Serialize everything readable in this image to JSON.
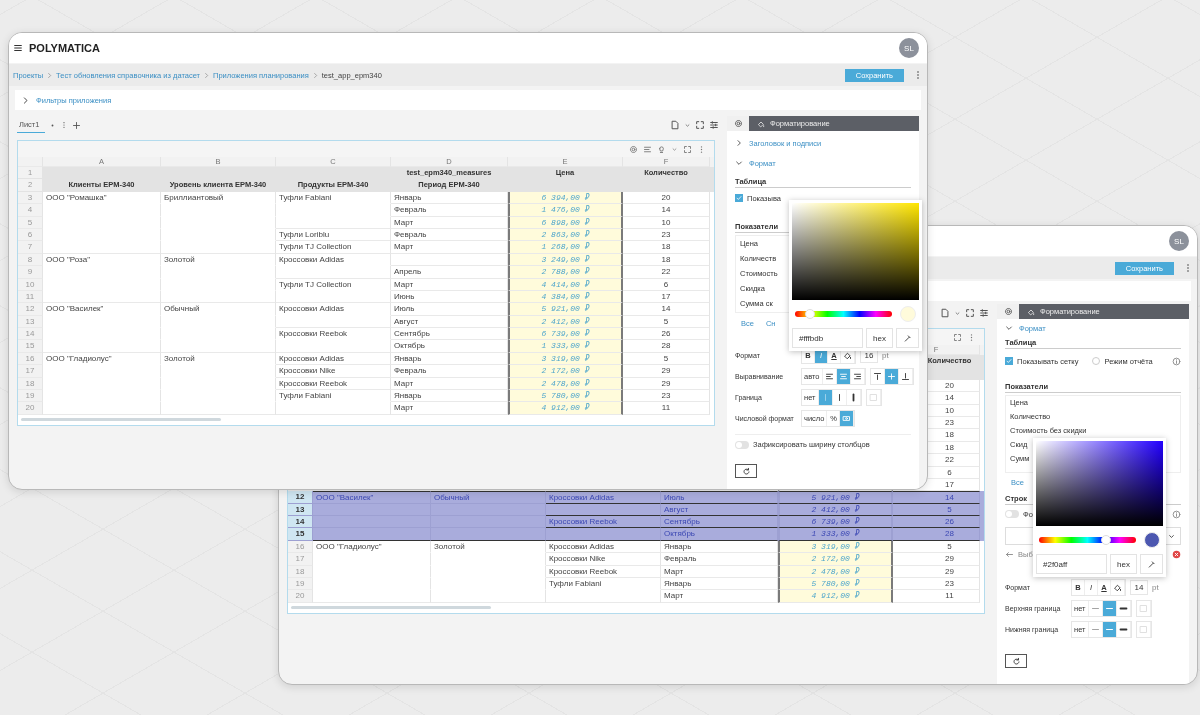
{
  "front_window": {
    "logo": "POLYMATICA",
    "avatar": "SL",
    "breadcrumbs": [
      "Проекты",
      "Тест обновления справочника из датасет",
      "Приложения планирования",
      "test_app_epm340"
    ],
    "save_button": "Сохранить",
    "filters": {
      "label": "Фильтры приложения",
      "expanded": false
    },
    "sheet_tabs": [
      {
        "label": "Лист1",
        "selected": true
      }
    ],
    "table": {
      "header_row_numbers": [
        "1",
        "2"
      ],
      "measures_title": "test_epm340_measures",
      "columns": [
        {
          "letter": "A",
          "title": "Клиенты EPM-340"
        },
        {
          "letter": "B",
          "title": "Уровень клиента EPM-340"
        },
        {
          "letter": "C",
          "title": "Продукты EPM-340"
        },
        {
          "letter": "D",
          "title": "Период EPM-340"
        },
        {
          "letter": "E",
          "title": "Цена"
        },
        {
          "letter": "F",
          "title": "Количество"
        }
      ],
      "rows": [
        {
          "num": "3",
          "client": "ООО \"Ромашка\"",
          "level": "Бриллиантовый",
          "product": "Туфли Fabiani",
          "period": "Январь",
          "price": "6 394,00 ₽",
          "quantity": "20"
        },
        {
          "num": "4",
          "period": "Февраль",
          "price": "1 476,00 ₽",
          "quantity": "14"
        },
        {
          "num": "5",
          "period": "Март",
          "price": "6 898,00 ₽",
          "quantity": "10"
        },
        {
          "num": "6",
          "product": "Туфли Loriblu",
          "period": "Февраль",
          "price": "2 863,00 ₽",
          "quantity": "23"
        },
        {
          "num": "7",
          "product": "Туфли TJ Collection",
          "period": "Март",
          "price": "1 268,00 ₽",
          "quantity": "18"
        },
        {
          "num": "8",
          "client": "ООО \"Роза\"",
          "level": "Золотой",
          "product": "Кроссовки Adidas",
          "price": "3 249,00 ₽",
          "quantity": "18"
        },
        {
          "num": "9",
          "period": "Апрель",
          "price": "2 788,00 ₽",
          "quantity": "22"
        },
        {
          "num": "10",
          "product": "Туфли TJ Collection",
          "period": "Март",
          "price": "4 414,00 ₽",
          "quantity": "6"
        },
        {
          "num": "11",
          "period": "Июнь",
          "price": "4 384,00 ₽",
          "quantity": "17"
        },
        {
          "num": "12",
          "client": "ООО \"Василек\"",
          "level": "Обычный",
          "product": "Кроссовки Adidas",
          "period": "Июль",
          "price": "5 921,00 ₽",
          "quantity": "14"
        },
        {
          "num": "13",
          "period": "Август",
          "price": "2 412,00 ₽",
          "quantity": "5"
        },
        {
          "num": "14",
          "product": "Кроссовки Reebok",
          "period": "Сентябрь",
          "price": "6 739,00 ₽",
          "quantity": "26"
        },
        {
          "num": "15",
          "period": "Октябрь",
          "price": "1 333,00 ₽",
          "quantity": "28"
        },
        {
          "num": "16",
          "client": "ООО \"Гладиолус\"",
          "level": "Золотой",
          "product": "Кроссовки Adidas",
          "period": "Январь",
          "price": "3 319,00 ₽",
          "quantity": "5"
        },
        {
          "num": "17",
          "product": "Кроссовки Nike",
          "period": "Февраль",
          "price": "2 172,00 ₽",
          "quantity": "29"
        },
        {
          "num": "18",
          "product": "Кроссовки Reebok",
          "period": "Март",
          "price": "2 478,00 ₽",
          "quantity": "29"
        },
        {
          "num": "19",
          "product": "Туфли Fabiani",
          "period": "Январь",
          "price": "5 780,00 ₽",
          "quantity": "23"
        },
        {
          "num": "20",
          "period": "Март",
          "price": "4 912,00 ₽",
          "quantity": "11"
        }
      ]
    },
    "panel": {
      "tabs": [
        {
          "kind": "settings",
          "selected": false
        },
        {
          "kind": "formatting",
          "label": "Форматирование",
          "selected": true
        }
      ],
      "sections": [
        {
          "label": "Заголовок и подписи",
          "expanded": false
        },
        {
          "label": "Формат",
          "expanded": true
        }
      ],
      "table_heading": "Таблица",
      "show_grid": {
        "label": "Показыва",
        "checked": true
      },
      "measures_heading": "Показатели",
      "measures": [
        "Цена",
        "Количеств",
        "Стоимость",
        "Скидка",
        "Сумма ск"
      ],
      "links": [
        "Все",
        "Сн"
      ],
      "settings": [
        {
          "label": "Формат",
          "groups": [
            [
              {
                "kind": "bold",
                "label": "B",
                "selected": false
              },
              {
                "kind": "italic",
                "label": "I",
                "selected": true
              },
              {
                "kind": "font-color",
                "label": "A",
                "selected": false
              },
              {
                "kind": "fill",
                "selected": false
              }
            ]
          ],
          "size": "16",
          "unit": "pt"
        },
        {
          "label": "Выравнивание",
          "groups": [
            [
              {
                "kind": "text",
                "label": "авто",
                "selected": false
              },
              {
                "kind": "align-left",
                "selected": false
              },
              {
                "kind": "align-center",
                "selected": true
              },
              {
                "kind": "align-right",
                "selected": false
              }
            ],
            [
              {
                "kind": "valign-top",
                "selected": false
              },
              {
                "kind": "valign-middle",
                "selected": true
              },
              {
                "kind": "valign-bottom",
                "selected": false
              }
            ]
          ]
        },
        {
          "label": "Граница",
          "groups": [
            [
              {
                "kind": "text",
                "label": "нет",
                "selected": false
              },
              {
                "kind": "vline-thin",
                "selected": true
              },
              {
                "kind": "vline-medium",
                "selected": false
              },
              {
                "kind": "vline-thick",
                "selected": false
              }
            ],
            [
              {
                "kind": "swatch",
                "selected": false
              }
            ]
          ]
        },
        {
          "label": "Числовой формат",
          "groups": [
            [
              {
                "kind": "text",
                "label": "число",
                "selected": false
              },
              {
                "kind": "text",
                "label": "%",
                "selected": false
              },
              {
                "kind": "money",
                "selected": true
              }
            ]
          ]
        }
      ],
      "fix_width": {
        "label": "Зафиксировать ширину столбцов",
        "on": false
      },
      "picker": {
        "level": 0.15,
        "color": "#fffbdb",
        "value": "#fffbdb",
        "format": "hex"
      }
    }
  },
  "back_window": {
    "avatar": "SL",
    "save_button": "Сохранить",
    "table": {
      "column_letter": "F",
      "column_title": "Количество",
      "upper_quantities": [
        "20",
        "14",
        "10",
        "23",
        "18",
        "18",
        "22",
        "6",
        "17"
      ],
      "rows": [
        {
          "num": "12",
          "client": "ООО \"Василек\"",
          "level": "Обычный",
          "product": "Кроссовки Adidas",
          "period": "Июль",
          "price": "5 921,00 ₽",
          "quantity": "14",
          "selected": true
        },
        {
          "num": "13",
          "period": "Август",
          "price": "2 412,00 ₽",
          "quantity": "5",
          "selected": true
        },
        {
          "num": "14",
          "product": "Кроссовки Reebok",
          "period": "Сентябрь",
          "price": "6 739,00 ₽",
          "quantity": "26",
          "selected": true
        },
        {
          "num": "15",
          "period": "Октябрь",
          "price": "1 333,00 ₽",
          "quantity": "28",
          "selected": true
        },
        {
          "num": "16",
          "client": "ООО \"Гладиолус\"",
          "level": "Золотой",
          "product": "Кроссовки Adidas",
          "period": "Январь",
          "price": "3 319,00 ₽",
          "quantity": "5",
          "selected": false
        },
        {
          "num": "17",
          "product": "Кроссовки Nike",
          "period": "Февраль",
          "price": "2 172,00 ₽",
          "quantity": "29",
          "selected": false
        },
        {
          "num": "18",
          "product": "Кроссовки Reebok",
          "period": "Март",
          "price": "2 478,00 ₽",
          "quantity": "29",
          "selected": false
        },
        {
          "num": "19",
          "product": "Туфли Fabiani",
          "period": "Январь",
          "price": "5 780,00 ₽",
          "quantity": "23",
          "selected": false
        },
        {
          "num": "20",
          "period": "Март",
          "price": "4 912,00 ₽",
          "quantity": "11",
          "selected": false
        }
      ]
    },
    "panel": {
      "tabs": [
        {
          "kind": "settings",
          "selected": false
        },
        {
          "kind": "formatting",
          "label": "Форматирование",
          "selected": true
        }
      ],
      "sections": [
        {
          "label": "Формат",
          "expanded": true
        }
      ],
      "table_heading": "Таблица",
      "show_grid": {
        "label": "Показывать сетку",
        "checked": true
      },
      "report_mode": {
        "label": "Режим отчёта",
        "checked": false
      },
      "measures_heading": "Показатели",
      "measures": [
        "Цена",
        "Количество",
        "Стоимость без скидки",
        "Скид",
        "Сумм"
      ],
      "links": [
        "Все"
      ],
      "rows_heading": "Строк",
      "rows_toggle": {
        "label": "Фо",
        "on": false
      },
      "back_link": "Выб",
      "settings": [
        {
          "label": "Формат",
          "groups": [
            [
              {
                "kind": "bold",
                "label": "B",
                "selected": false
              },
              {
                "kind": "italic",
                "label": "I",
                "selected": false
              },
              {
                "kind": "font-color",
                "label": "A",
                "selected": false
              },
              {
                "kind": "fill",
                "selected": false
              }
            ]
          ],
          "size": "14",
          "unit": "pt"
        },
        {
          "label": "Верхняя граница",
          "groups": [
            [
              {
                "kind": "text",
                "label": "нет",
                "selected": false
              },
              {
                "kind": "hline-thin",
                "selected": false
              },
              {
                "kind": "hline-medium",
                "selected": true
              },
              {
                "kind": "hline-thick",
                "selected": false
              }
            ],
            [
              {
                "kind": "swatch",
                "selected": false
              }
            ]
          ]
        },
        {
          "label": "Нижняя граница",
          "groups": [
            [
              {
                "kind": "text",
                "label": "нет",
                "selected": false
              },
              {
                "kind": "hline-thin",
                "selected": false
              },
              {
                "kind": "hline-medium",
                "selected": true
              },
              {
                "kind": "hline-thick",
                "selected": false
              }
            ],
            [
              {
                "kind": "swatch",
                "selected": false
              }
            ]
          ]
        }
      ],
      "picker": {
        "level": 0.69,
        "color": "#4c57b0",
        "value": "#2f0aff",
        "format": "hex"
      }
    }
  }
}
